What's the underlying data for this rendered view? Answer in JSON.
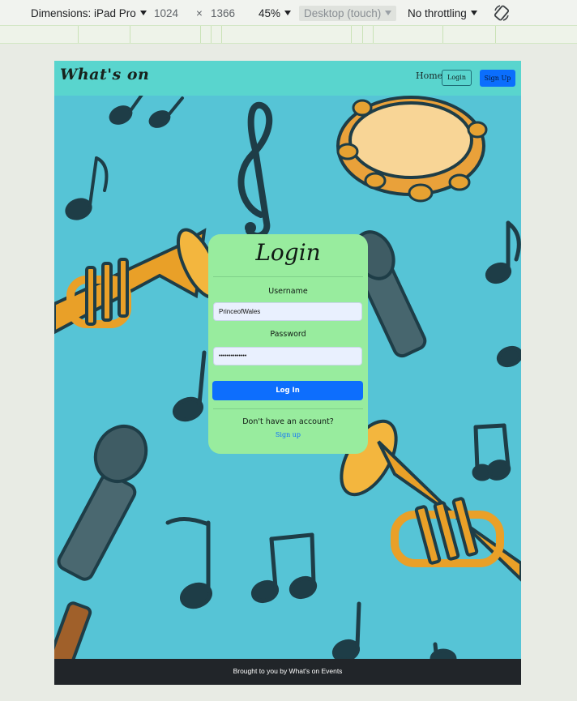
{
  "devtools": {
    "dimensions_label": "Dimensions: iPad Pro",
    "width": "1024",
    "times": "×",
    "height": "1366",
    "zoom": "45%",
    "device_type": "Desktop (touch)",
    "throttling": "No throttling",
    "rotate_icon": "rotate-icon"
  },
  "navbar": {
    "brand": "What's on",
    "home": "Home",
    "login": "Login",
    "signup": "Sign Up"
  },
  "login_card": {
    "title": "Login",
    "username_label": "Username",
    "username_value": "PrinceofWales",
    "password_label": "Password",
    "password_value": "••••••••••••••",
    "submit": "Log In",
    "no_account": "Don't have an account?",
    "signup_link": "Sign up"
  },
  "footer": {
    "text": "Brought to you by What's on Events"
  },
  "colors": {
    "page_bg": "#56c4d6",
    "navbar": "#59d5ce",
    "card": "#98ec9e",
    "primary": "#0d6efd",
    "footer": "#212529"
  }
}
